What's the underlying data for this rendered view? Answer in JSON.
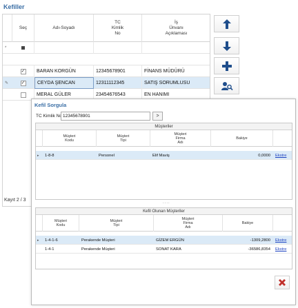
{
  "kefiller": {
    "title": "Kefiller",
    "columns": [
      "Seç",
      "Adı-Soyadı",
      "TC\nKimlik\nNo",
      "İş\nÜnvanı\nAçıklaması"
    ],
    "rows": [
      {
        "name": "BARAN KORGÜN",
        "tc": "12345678901",
        "job": "FİNANS MÜDÜRÜ",
        "checked": true,
        "selected": false
      },
      {
        "name": "CEYDA ŞENCAN",
        "tc": "12311112345",
        "job": "SATIŞ SORUMLUSU",
        "checked": true,
        "selected": true
      },
      {
        "name": "MERAL GÜLER",
        "tc": "23454676543",
        "job": "EN HANIMI",
        "checked": false,
        "selected": false
      }
    ],
    "record_info": "Kayıt 2 / 3"
  },
  "side_buttons": {
    "move_up_icon": "arrow-up-icon",
    "move_down_icon": "arrow-down-icon",
    "add_icon": "plus-icon",
    "search_person_icon": "user-search-icon"
  },
  "kefil_sorgula": {
    "title": "Kefil Sorgula",
    "tc_label": "TC Kimlik No",
    "tc_value": "12345678901",
    "go_button": ">",
    "musteriler": {
      "caption": "Müşteriler",
      "columns": [
        "Müşteri\nKodu",
        "Müşteri\nTipi",
        "Müşteri\nFirma\nAdı",
        "Bakiye",
        ""
      ],
      "rows": [
        {
          "code": "1-8-8",
          "type": "Personel",
          "name": "Elif Maviş",
          "balance": "0,0000",
          "link": "Ekstre",
          "selected": true
        }
      ]
    },
    "splitter": "....",
    "kefil_olunan": {
      "caption": "Kefil Olunan Müşteriler",
      "columns": [
        "Müşteri\nKodu",
        "Müşteri\nTipi",
        "Müşteri\nFirma\nAdı",
        "Bakiye",
        ""
      ],
      "rows": [
        {
          "code": "1-4-1-6",
          "type": "Perakende Müşteri",
          "name": "GİZEM ERGÜN",
          "balance": "-1309,2800",
          "link": "Ekstre",
          "selected": true
        },
        {
          "code": "1-4-1",
          "type": "Perakende Müşteri",
          "name": "SONAT KARA",
          "balance": "-36586,8354",
          "link": "Ekstre",
          "selected": false
        }
      ]
    },
    "close_icon": "close-icon"
  },
  "colors": {
    "title_blue": "#3a6ea5",
    "selection": "#dbeaf7",
    "button_icon_blue": "#1f4e8c",
    "close_red": "#c0302b",
    "link": "#1a3fbf"
  }
}
